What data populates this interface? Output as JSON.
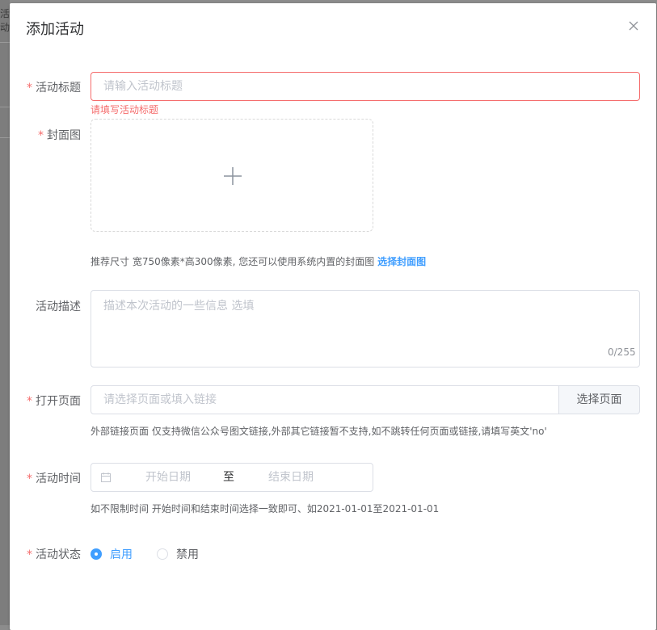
{
  "backdrop": {
    "fragment": "活动"
  },
  "dialog": {
    "title": "添加活动"
  },
  "form": {
    "title": {
      "label": "活动标题",
      "required_mark": "*",
      "placeholder": "请输入活动标题",
      "value": "",
      "error": "请填写活动标题"
    },
    "cover": {
      "label": "封面图",
      "required_mark": "*",
      "hint": "推荐尺寸 宽750像素*高300像素, 您还可以使用系统内置的封面图",
      "hint_link": "选择封面图"
    },
    "description": {
      "label": "活动描述",
      "placeholder": "描述本次活动的一些信息 选填",
      "counter": "0/255"
    },
    "page": {
      "label": "打开页面",
      "required_mark": "*",
      "placeholder": "请选择页面或填入链接",
      "button": "选择页面",
      "hint": "外部链接页面 仅支持微信公众号图文链接,外部其它链接暂不支持,如不跳转任何页面或链接,请填写英文'no'"
    },
    "time": {
      "label": "活动时间",
      "required_mark": "*",
      "start_placeholder": "开始日期",
      "separator": "至",
      "end_placeholder": "结束日期",
      "hint": "如不限制时间 开始时间和结束时间选择一致即可、如2021-01-01至2021-01-01"
    },
    "status": {
      "label": "活动状态",
      "required_mark": "*",
      "options": [
        {
          "label": "启用",
          "checked": true
        },
        {
          "label": "禁用",
          "checked": false
        }
      ]
    }
  },
  "colors": {
    "primary": "#409eff",
    "error": "#f56c6c",
    "border": "#dcdfe6",
    "placeholder": "#c0c4cc"
  }
}
